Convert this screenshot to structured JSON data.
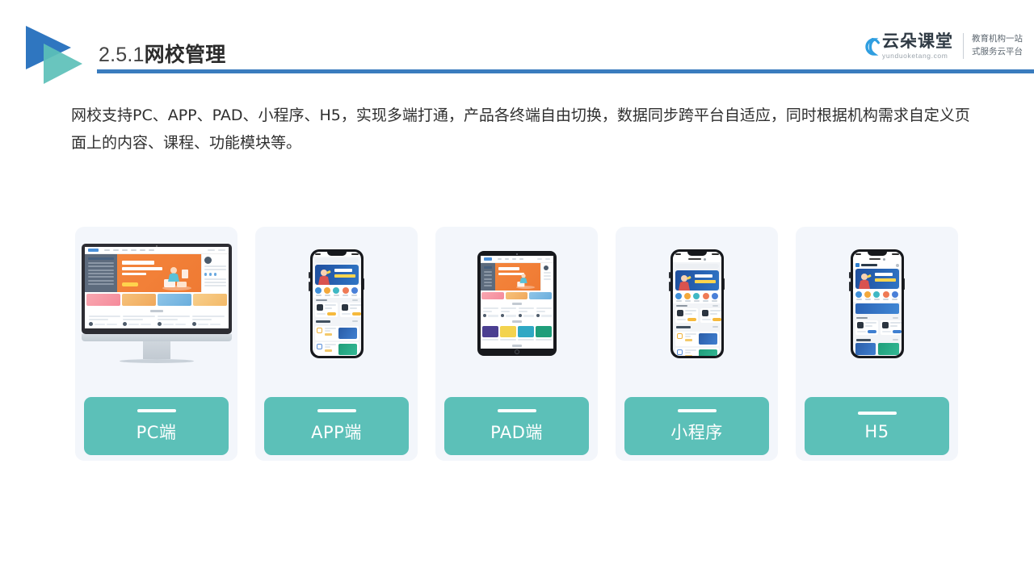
{
  "header": {
    "section_number": "2.5.1",
    "section_title": "网校管理",
    "rule_color": "#3a7cbe",
    "logo_blue": "#2f76c0",
    "logo_teal": "#5cc0b8"
  },
  "brand": {
    "name_cn": "云朵课堂",
    "domain": "yunduoketang.com",
    "tagline_line1": "教育机构一站",
    "tagline_line2": "式服务云平台",
    "cloud_color": "#2f9ee0"
  },
  "body": {
    "paragraph": "网校支持PC、APP、PAD、小程序、H5，实现多端打通，产品各终端自由切换，数据同步跨平台自适应，同时根据机构需求自定义页面上的内容、课程、功能模块等。"
  },
  "cards": [
    {
      "id": "pc",
      "label": "PC端",
      "device": "desktop-monitor"
    },
    {
      "id": "app",
      "label": "APP端",
      "device": "smartphone"
    },
    {
      "id": "pad",
      "label": "PAD端",
      "device": "tablet"
    },
    {
      "id": "miniapp",
      "label": "小程序",
      "device": "smartphone"
    },
    {
      "id": "h5",
      "label": "H5",
      "device": "smartphone"
    }
  ],
  "theme": {
    "card_background": "#f3f6fb",
    "label_background": "#5cc0b8",
    "label_text": "#ffffff",
    "page_background": "#ffffff",
    "body_text": "#2f2f2f"
  }
}
